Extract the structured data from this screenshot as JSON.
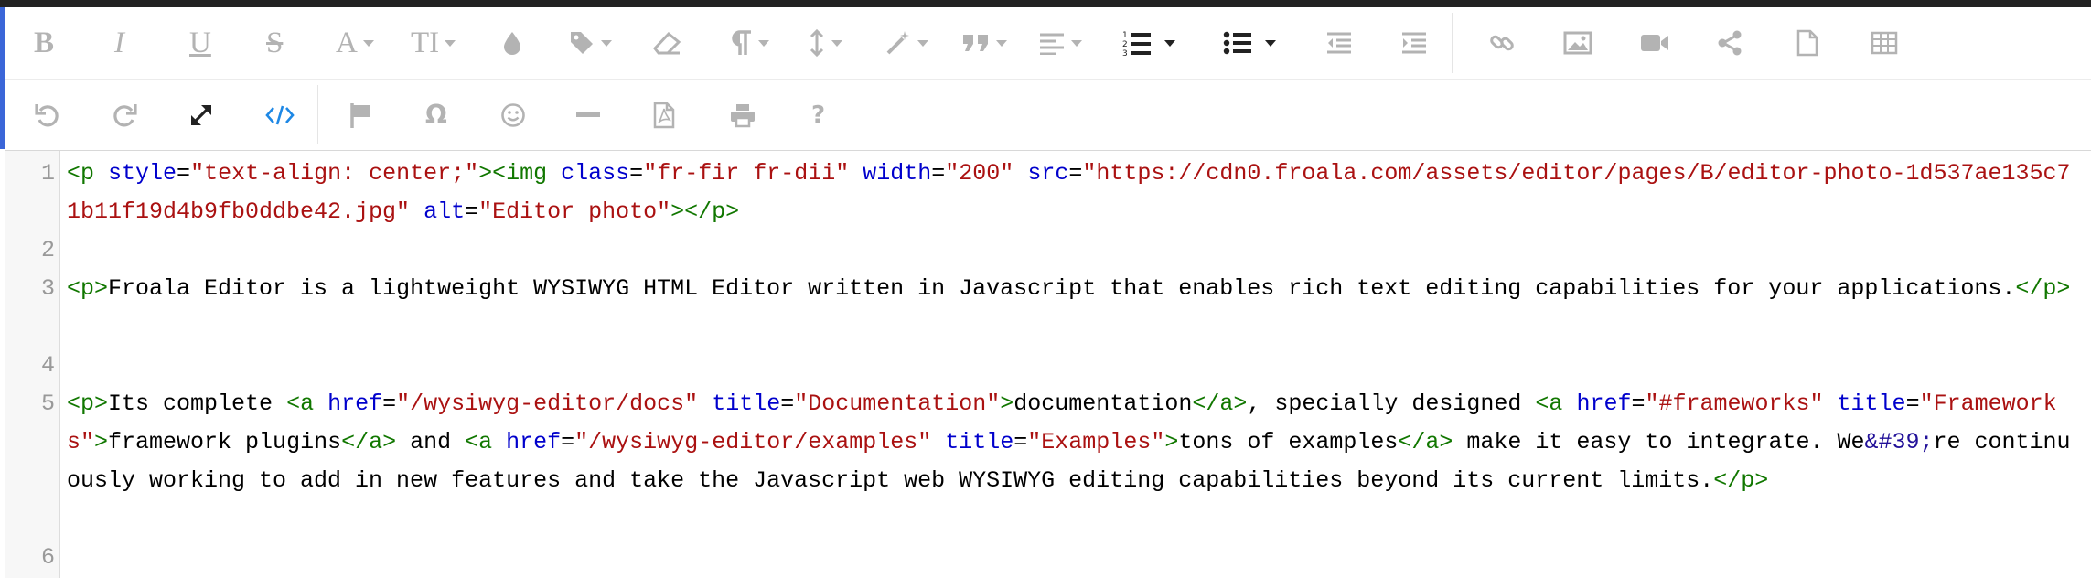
{
  "toolbar": {
    "row1": [
      {
        "name": "bold-button",
        "glyph": "B"
      },
      {
        "name": "italic-button",
        "glyph": "I"
      },
      {
        "name": "underline-button",
        "glyph": "U"
      },
      {
        "name": "strikethrough-button",
        "glyph": "S"
      },
      {
        "name": "font-family-button",
        "glyph": "A"
      },
      {
        "name": "font-size-button",
        "glyph": "TI"
      },
      {
        "name": "text-color-button",
        "icon": "droplet-icon"
      },
      {
        "name": "paragraph-style-button",
        "icon": "tag-icon"
      },
      {
        "name": "clear-formatting-button",
        "icon": "eraser-icon"
      },
      {
        "name": "paragraph-format-button",
        "icon": "pilcrow-icon"
      },
      {
        "name": "line-height-button",
        "icon": "line-height-icon"
      },
      {
        "name": "inline-style-button",
        "icon": "magic-wand-icon"
      },
      {
        "name": "quote-button",
        "icon": "quote-icon"
      },
      {
        "name": "align-button",
        "icon": "align-left-icon"
      },
      {
        "name": "ordered-list-button",
        "icon": "ordered-list-icon"
      },
      {
        "name": "unordered-list-button",
        "icon": "unordered-list-icon"
      },
      {
        "name": "outdent-button",
        "icon": "outdent-icon"
      },
      {
        "name": "indent-button",
        "icon": "indent-icon"
      },
      {
        "name": "insert-link-button",
        "icon": "link-icon"
      },
      {
        "name": "insert-image-button",
        "icon": "image-icon"
      },
      {
        "name": "insert-video-button",
        "icon": "video-icon"
      },
      {
        "name": "embed-button",
        "icon": "share-icon"
      },
      {
        "name": "insert-file-button",
        "icon": "file-icon"
      },
      {
        "name": "insert-table-button",
        "icon": "table-icon"
      }
    ],
    "row2": [
      {
        "name": "undo-button",
        "icon": "undo-icon"
      },
      {
        "name": "redo-button",
        "icon": "redo-icon"
      },
      {
        "name": "fullscreen-button",
        "icon": "expand-icon"
      },
      {
        "name": "code-view-button",
        "icon": "code-icon"
      },
      {
        "name": "emoticons-flag-button",
        "icon": "flag-icon"
      },
      {
        "name": "special-characters-button",
        "glyph": "Ω"
      },
      {
        "name": "emoticons-button",
        "icon": "smiley-icon"
      },
      {
        "name": "horizontal-line-button",
        "icon": "minus-icon"
      },
      {
        "name": "get-pdf-button",
        "icon": "pdf-icon"
      },
      {
        "name": "print-button",
        "icon": "printer-icon"
      },
      {
        "name": "help-button",
        "glyph": "?"
      }
    ]
  },
  "code": {
    "line_numbers": [
      "1",
      "2",
      "3",
      "4",
      "5",
      "6"
    ],
    "line1": {
      "p_open": "<p",
      "style_attr": "style",
      "style_val": "\"text-align: center;\"",
      "p_close_img_open": "><img",
      "class_attr": "class",
      "class_val": "\"fr-fir fr-dii\"",
      "width_attr": "width",
      "width_val": "\"200\"",
      "src_attr": "src",
      "src_val": "\"https://cdn0.froala.com/assets/editor/pages/B/editor-photo-1d537ae135c71b11f19d4b9fb0ddbe42.jpg\"",
      "alt_attr": "alt",
      "alt_val": "\"Editor photo\"",
      "end": "></p>"
    },
    "line3": {
      "open": "<p>",
      "text": "Froala Editor is a lightweight WYSIWYG HTML Editor written in Javascript that enables rich text editing capabilities for your applications.",
      "close": "</p>"
    },
    "line5": {
      "p_open": "<p>",
      "text1": "Its complete ",
      "a1_open": "<a",
      "href_attr": "href",
      "a1_href": "\"/wysiwyg-editor/docs\"",
      "title_attr": "title",
      "a1_title": "\"Documentation\"",
      "gt": ">",
      "a1_text": "documentation",
      "a_close": "</a>",
      "text2": ", specially designed ",
      "a2_href": "\"#frameworks\"",
      "a2_title": "\"Frameworks\"",
      "a2_text": "framework plugins",
      "text3": " and ",
      "a3_href": "\"/wysiwyg-editor/examples\"",
      "a3_title": "\"Examples\"",
      "a3_text": "tons of examples",
      "text4": " make it easy to integrate. We",
      "entity": "&#39;",
      "text5": "re continuously working to add in new features and take the Javascript web WYSIWYG editing capabilities beyond its current limits.",
      "p_close": "</p>"
    }
  }
}
